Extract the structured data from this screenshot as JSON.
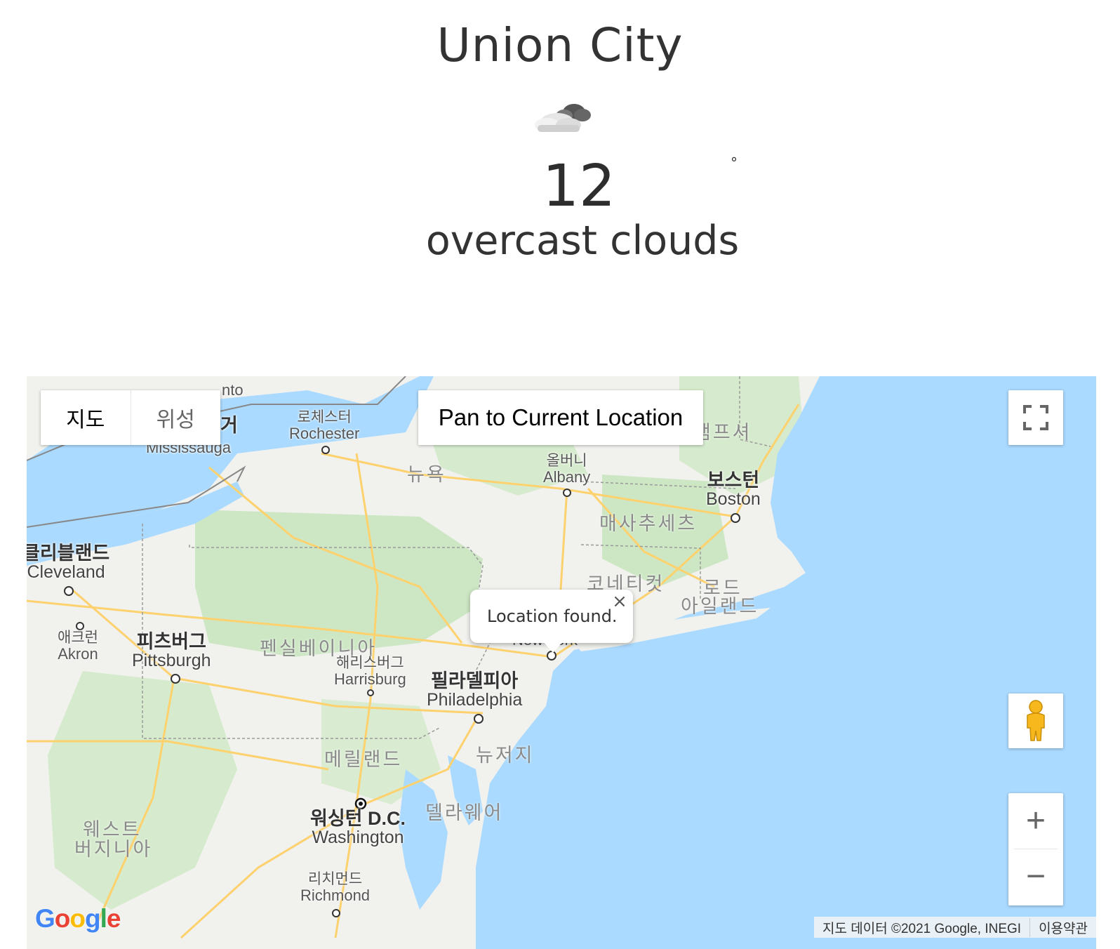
{
  "weather": {
    "city": "Union City",
    "icon": "overcast-clouds-icon",
    "temperature": "12",
    "degree_symbol": "°",
    "description": "overcast clouds"
  },
  "map": {
    "map_type": {
      "map_label": "지도",
      "satellite_label": "위성",
      "selected": "지도"
    },
    "pan_button_label": "Pan to Current Location",
    "info_window": {
      "text": "Location found.",
      "close": "×"
    },
    "zoom_in": "+",
    "zoom_out": "−",
    "fullscreen_icon": "fullscreen-icon",
    "pegman_icon": "street-view-pegman-icon",
    "logo": {
      "G": "G",
      "o1": "o",
      "o2": "o",
      "g": "g",
      "l": "l",
      "e": "e"
    },
    "logo_colors": [
      "#4285F4",
      "#EA4335",
      "#FBBC05",
      "#4285F4",
      "#34A853",
      "#EA4335"
    ],
    "attribution": "지도 데이터 ©2021 Google, INEGI",
    "terms": "이용약관",
    "colors": {
      "water": "#aadaff",
      "land": "#f1f1ee",
      "park": "#cde7c4",
      "road": "#fdd26e"
    },
    "places": {
      "toronto_partial": "nto",
      "toronto_ko_partial": "거",
      "mississauga": "Mississauga",
      "rochester_ko": "로체스터",
      "rochester": "Rochester",
      "ny_state": "뉴욕",
      "albany_ko": "올버니",
      "albany": "Albany",
      "new_hampshire_partial": "햄프셔",
      "boston_ko": "보스턴",
      "boston": "Boston",
      "massachusetts": "매사추세츠",
      "cleveland_ko": "클리블랜드",
      "cleveland": "Cleveland",
      "connecticut": "코네티컷",
      "rhode_island_1": "로드",
      "rhode_island_2": "아일랜드",
      "akron_ko": "애크런",
      "akron": "Akron",
      "pittsburgh_ko": "피츠버그",
      "pittsburgh": "Pittsburgh",
      "pennsylvania": "펜실베이니아",
      "harrisburg_ko": "해리스버그",
      "harrisburg": "Harrisburg",
      "new_york_city": "New York",
      "philadelphia_ko": "필라델피아",
      "philadelphia": "Philadelphia",
      "new_jersey": "뉴저지",
      "maryland": "메릴랜드",
      "delaware": "델라웨어",
      "washington_ko": "워싱턴 D.C.",
      "washington": "Washington",
      "west_virginia_1": "웨스트",
      "west_virginia_2": "버지니아",
      "richmond_ko": "리치먼드",
      "richmond": "Richmond"
    }
  }
}
